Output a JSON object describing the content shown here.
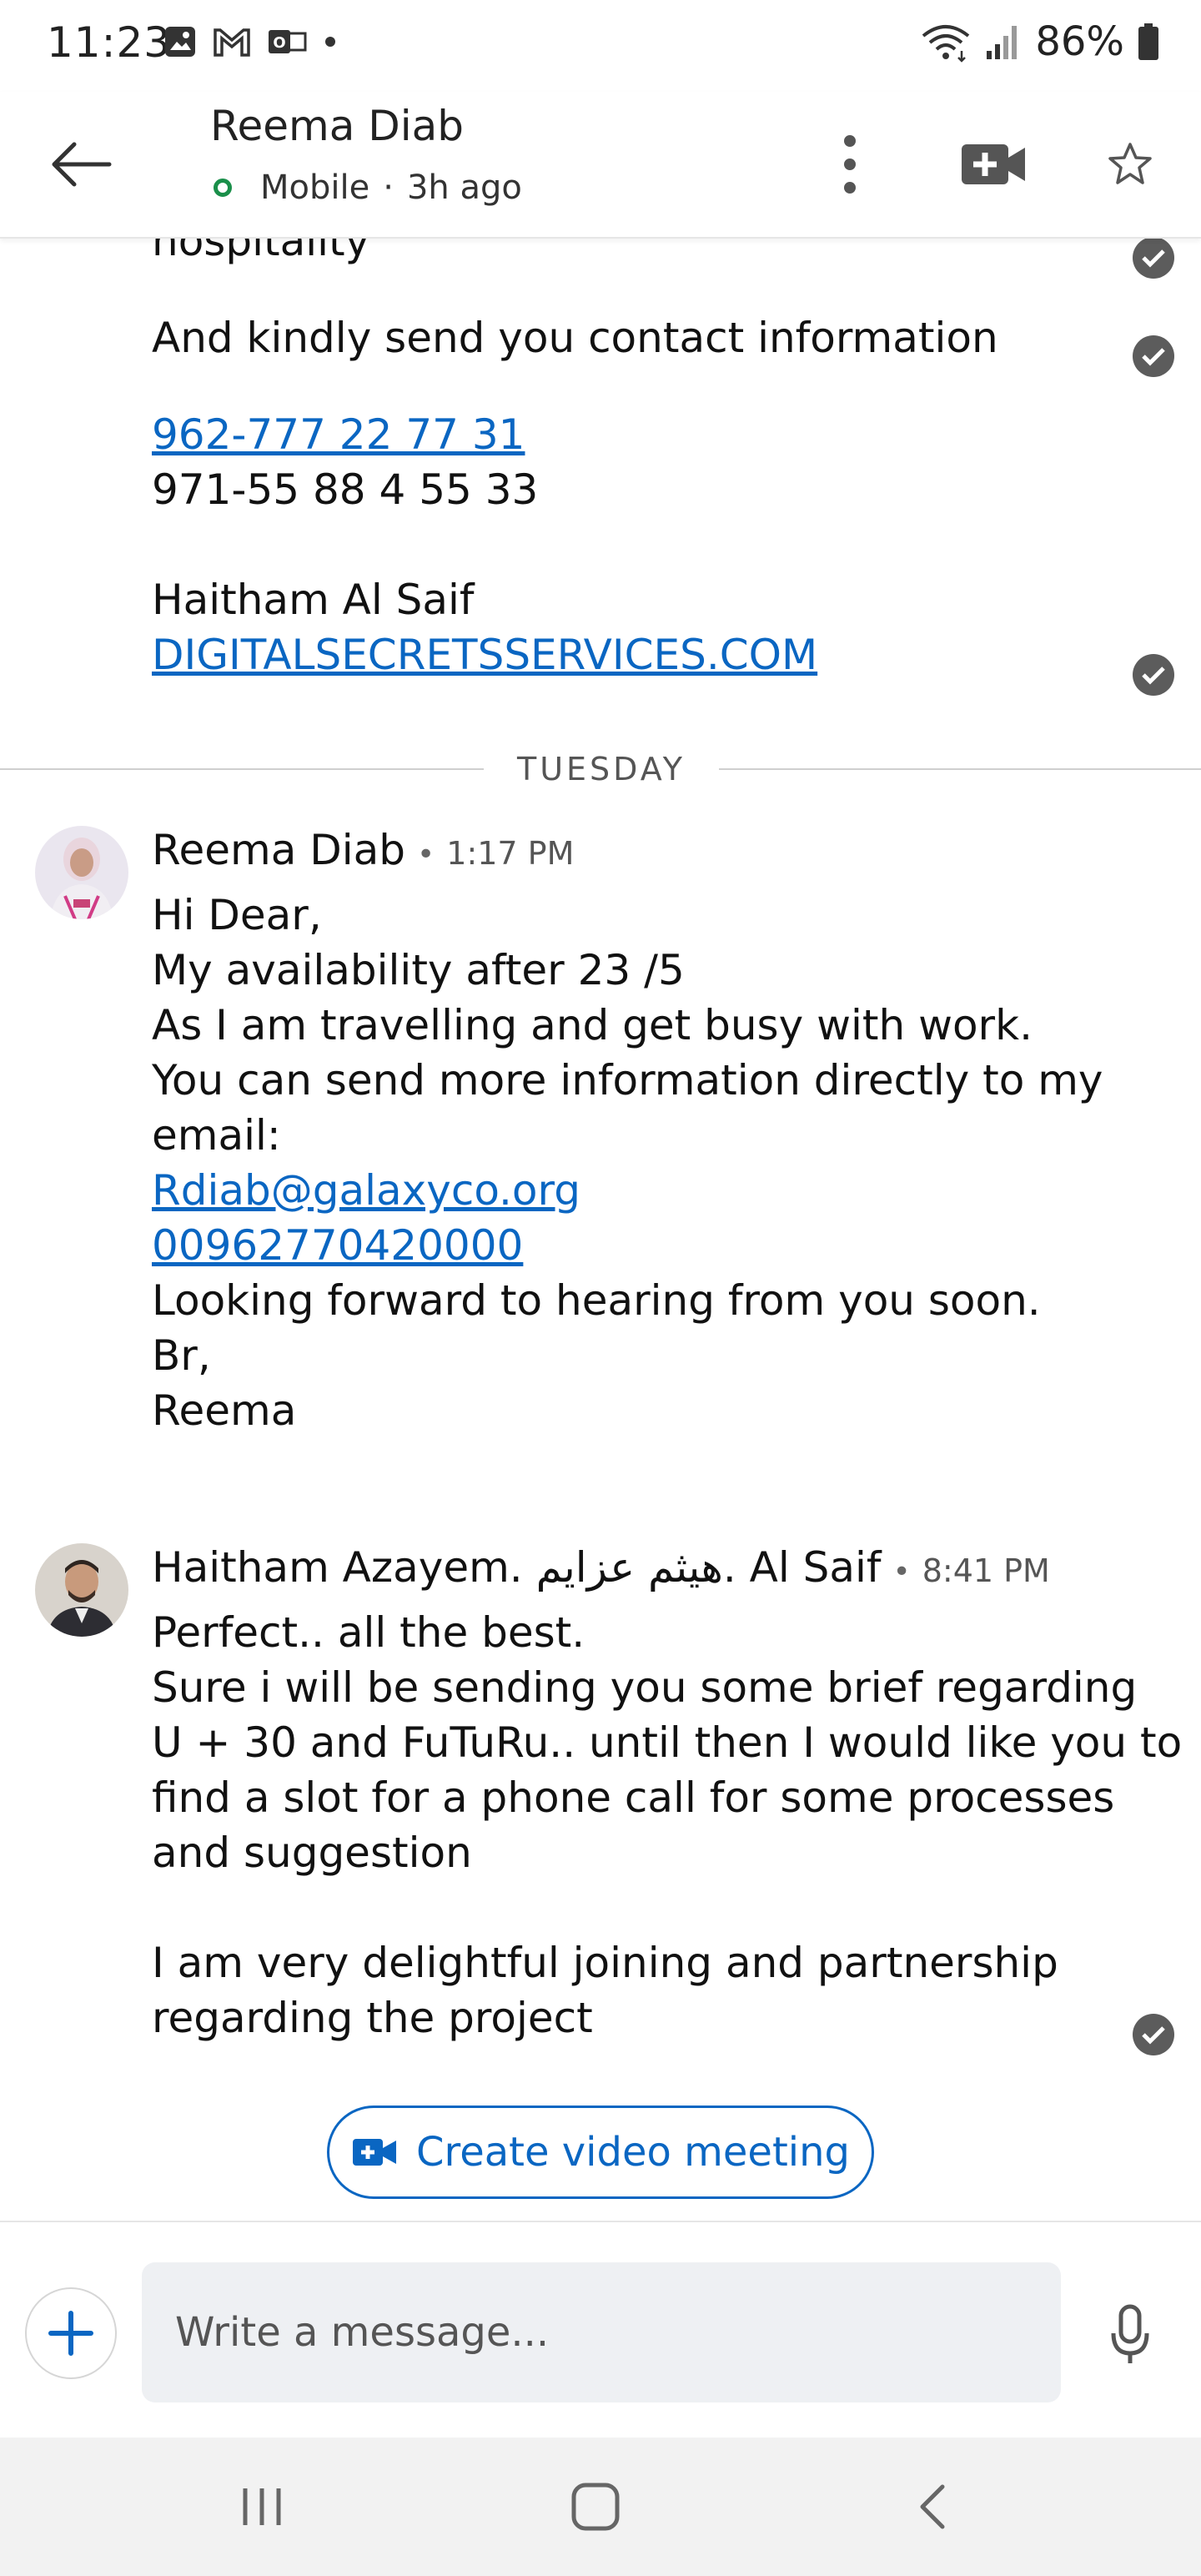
{
  "status_bar": {
    "time": "11:23",
    "battery": "86%"
  },
  "header": {
    "contact_name": "Reema Diab",
    "presence_label": "Mobile",
    "last_seen": "3h ago",
    "presence_color": "#1a8f4a"
  },
  "conversation": {
    "previous_message": {
      "line_cut": "hospitality",
      "line_contact": "And kindly send you contact information",
      "phone_link": "962-777 22 77 31",
      "phone_2": "971-55 88 4 55 33",
      "signature_name": "Haitham Al Saif",
      "website_link": "DIGITALSECRETSSERVICES.COM"
    },
    "day_divider": "TUESDAY",
    "messages": [
      {
        "sender": "Reema Diab",
        "time": "1:17 PM",
        "lines": [
          "Hi Dear,",
          "My availability after 23 /5",
          "As I am travelling and get busy with work.",
          "You can send more information directly to my",
          "email:"
        ],
        "email_link": "Rdiab@galaxyco.org",
        "phone_link": "00962770420000",
        "closing": [
          "Looking forward to hearing from you soon.",
          "Br,",
          "Reema"
        ]
      },
      {
        "sender": "Haitham Azayem. هيثم عزايم. Al Saif",
        "time": "8:41 PM",
        "lines": [
          "Perfect.. all the best.",
          "Sure i will be sending you some brief regarding",
          "U + 30 and FuTuRu.. until then I would like you to",
          "find a slot for a phone call for some processes",
          "and suggestion",
          "",
          "I am very delightful joining and partnership",
          "regarding the project"
        ]
      }
    ]
  },
  "actions": {
    "video_meeting_label": "Create video meeting"
  },
  "composer": {
    "placeholder": "Write a message..."
  },
  "colors": {
    "accent": "#0a66c2",
    "check_gray": "#5c5c5c"
  }
}
